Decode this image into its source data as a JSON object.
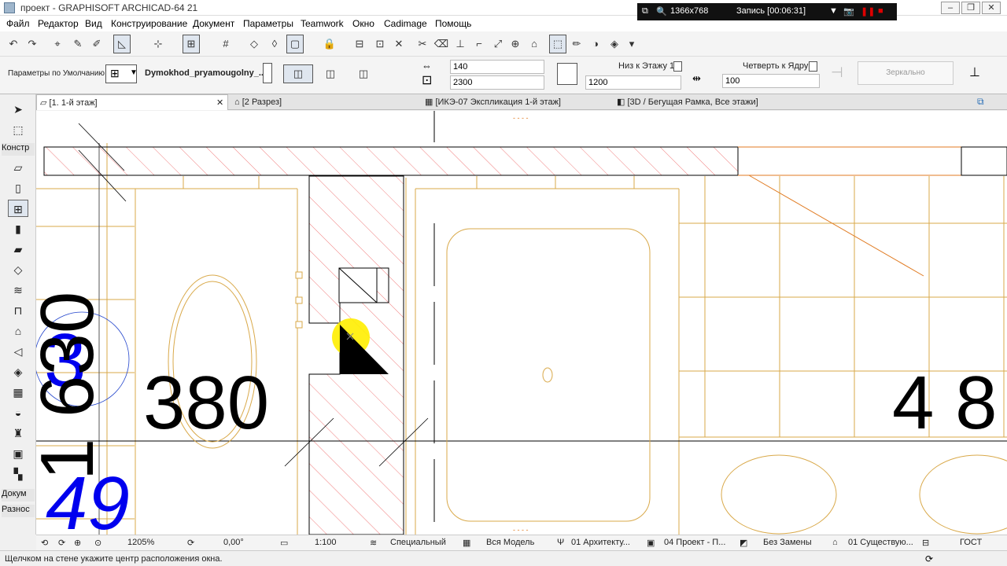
{
  "title": {
    "app_title": "проект - GRAPHISOFT ARCHICAD-64 21"
  },
  "recorder": {
    "resolution": "1366x768",
    "record_label": "Запись [00:06:31]"
  },
  "menu": [
    "Файл",
    "Редактор",
    "Вид",
    "Конструирование",
    "Документ",
    "Параметры",
    "Teamwork",
    "Окно",
    "Cadimage",
    "Помощь"
  ],
  "infobox": {
    "defaults_label": "Параметры по Умолчанию",
    "object_name": "Dymokhod_pryamougolny_...",
    "width_value": "140",
    "height_value": "2300",
    "anchor_label": "Низ к Этажу 1",
    "sill_value": "1200",
    "reveal_label": "Четверть к Ядру",
    "reveal_value": "100",
    "mirror_label": "Зеркально"
  },
  "tabs": [
    "[1. 1-й этаж]",
    "[2 Разрез]",
    "[ИКЭ-07 Экспликация 1-й этаж]",
    "[3D / Бегущая Рамка, Все этажи]"
  ],
  "toolbox": {
    "section_design": "Констр",
    "section_document": "Докум",
    "section_misc": "Разнос"
  },
  "dimensions": {
    "d1": "380",
    "d2": "4 8",
    "d3": "3",
    "d4": "49",
    "d5": "1 630"
  },
  "statusbar": {
    "zoom": "1205%",
    "angle": "0,00°",
    "scale": "1:100",
    "layer_combo": "Специальный",
    "model_view": "Вся Модель",
    "pen_set": "01 Архитекту...",
    "mvo": "04 Проект - П...",
    "override": "Без Замены",
    "renovation": "01 Существую...",
    "standard": "ГОСТ"
  },
  "hint": "Щелчком на стене укажите центр расположения окна.",
  "colors": {
    "wall_hatch": "#f08080",
    "orange_line": "#e07a20",
    "tile_line": "#d9a94a",
    "highlight": "#ffee00",
    "blue_text": "#0000ee"
  }
}
